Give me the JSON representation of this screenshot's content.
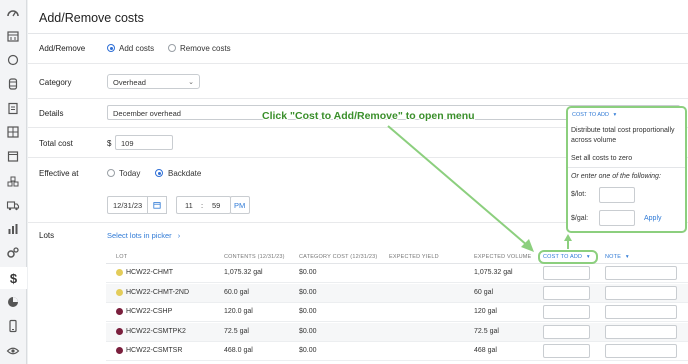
{
  "sidebar": {
    "icons": [
      "dashboard-icon",
      "calendar-icon",
      "circle-icon",
      "barrel-icon",
      "clipboard-icon",
      "grid-icon",
      "box-icon",
      "stack-icon",
      "truck-icon",
      "bar-chart-icon",
      "gears-icon",
      "dollar-icon",
      "pie-chart-icon",
      "phone-icon",
      "eye-icon"
    ],
    "active_icon": "dollar-icon"
  },
  "page": {
    "title": "Add/Remove costs"
  },
  "add_remove": {
    "label": "Add/Remove",
    "options": [
      "Add costs",
      "Remove costs"
    ],
    "selected": "Add costs"
  },
  "category": {
    "label": "Category",
    "value": "Overhead"
  },
  "details": {
    "label": "Details",
    "value": "December overhead"
  },
  "total_cost": {
    "label": "Total cost",
    "currency": "$",
    "value": "109"
  },
  "effective_at": {
    "label": "Effective at",
    "options": [
      "Today",
      "Backdate"
    ],
    "selected": "Backdate",
    "date": "12/31/23",
    "hour": "11",
    "separator": ":",
    "minute": "59",
    "ampm": "PM"
  },
  "lots": {
    "label": "Lots",
    "picker_link": "Select lots in picker",
    "picker_chevron": "›"
  },
  "table": {
    "headers": {
      "lot": "LOT",
      "contents": "CONTENTS (12/31/23)",
      "category_cost": "CATEGORY COST (12/31/23)",
      "expected_yield": "EXPECTED YIELD",
      "expected_volume": "EXPECTED VOLUME",
      "cost_to_add": "COST TO ADD",
      "note": "NOTE"
    },
    "rows": [
      {
        "lot": "HCW22-CHMT",
        "contents": "1,075.32 gal",
        "category_cost": "$0.00",
        "expected_volume": "1,075.32 gal",
        "dot_color": "#e3cc5a"
      },
      {
        "lot": "HCW22-CHMT-2ND",
        "contents": "60.0 gal",
        "category_cost": "$0.00",
        "expected_volume": "60 gal",
        "dot_color": "#e3cc5a"
      },
      {
        "lot": "HCW22-CSHP",
        "contents": "120.0 gal",
        "category_cost": "$0.00",
        "expected_volume": "120 gal",
        "dot_color": "#7a1f3d"
      },
      {
        "lot": "HCW22-CSMTPK2",
        "contents": "72.5 gal",
        "category_cost": "$0.00",
        "expected_volume": "72.5 gal",
        "dot_color": "#7a1f3d"
      },
      {
        "lot": "HCW22-CSMTSR",
        "contents": "468.0 gal",
        "category_cost": "$0.00",
        "expected_volume": "468 gal",
        "dot_color": "#7a1f3d"
      }
    ]
  },
  "popup": {
    "header": "COST TO ADD",
    "distribute": "Distribute total cost proportionally across volume",
    "set_zero": "Set all costs to zero",
    "or_enter": "Or enter one of the following:",
    "per_lot": "$/lot:",
    "per_gal": "$/gal:",
    "apply": "Apply"
  },
  "callout": "Click \"Cost to Add/Remove\" to open menu",
  "colors": {
    "accent": "#2f7ad6",
    "highlight": "#8ccf7e",
    "callout_text": "#3a8f2b"
  }
}
